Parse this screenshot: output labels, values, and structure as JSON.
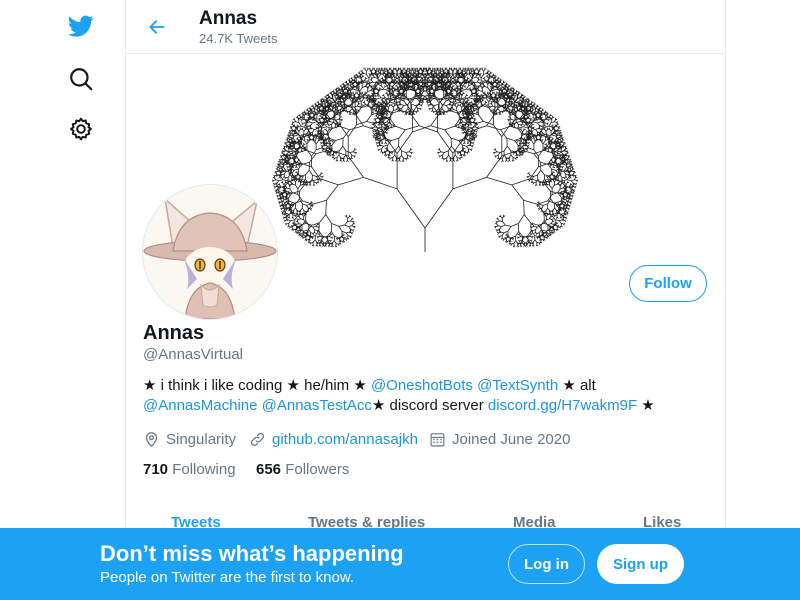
{
  "nav": {
    "icons": [
      "twitter-logo-icon",
      "search-icon",
      "settings-gear-icon"
    ]
  },
  "header": {
    "name": "Annas",
    "tweet_count": "24.7K Tweets"
  },
  "profile": {
    "display_name": "Annas",
    "handle": "@AnnasVirtual",
    "follow_label": "Follow",
    "bio": {
      "p1": "★ i think i like coding ★ he/him ★ ",
      "m1": "@OneshotBots",
      "m2": "@TextSynth",
      "p2": " ★ alt",
      "m3": "@AnnasMachine",
      "m4": "@AnnasTestAcc",
      "p3": "★ discord server ",
      "l1": "discord.gg/H7wakm9F",
      "p4": " ★"
    },
    "location": "Singularity",
    "website": "github.com/annasajkh",
    "joined": "Joined June 2020",
    "following_count": "710",
    "following_label": "Following",
    "followers_count": "656",
    "followers_label": "Followers"
  },
  "tabs": [
    "Tweets",
    "Tweets & replies",
    "Media",
    "Likes"
  ],
  "active_tab": "Tweets",
  "bottom_bar": {
    "title": "Don’t miss what’s happening",
    "subtitle": "People on Twitter are the first to know.",
    "login_label": "Log in",
    "signup_label": "Sign up"
  },
  "colors": {
    "accent": "#1da1f2",
    "link": "#1b95e0",
    "secondary_text": "#657786"
  }
}
